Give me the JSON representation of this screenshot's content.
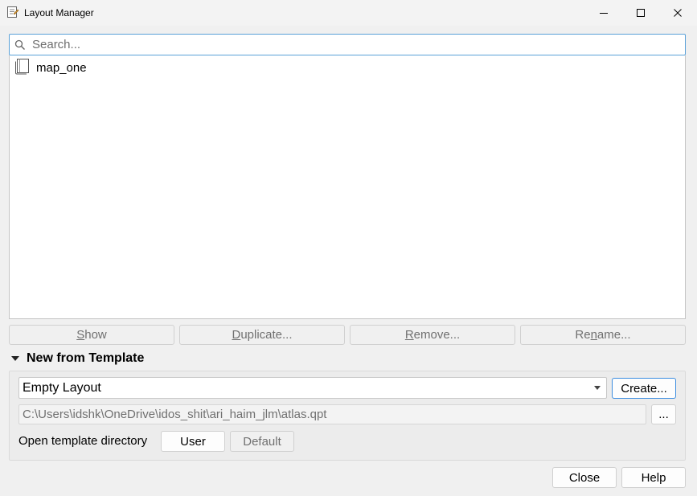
{
  "window": {
    "title": "Layout Manager",
    "icons": {
      "app": "layout-manager-icon",
      "minimize": "minimize-icon",
      "maximize": "maximize-icon",
      "close": "close-icon"
    }
  },
  "search": {
    "placeholder": "Search...",
    "value": "",
    "icon": "search-icon"
  },
  "layouts": {
    "items": [
      {
        "label": "map_one",
        "icon": "layout-page-icon"
      }
    ]
  },
  "actions": {
    "show": {
      "label": "Show",
      "underline": "S",
      "rest": "how",
      "enabled": false
    },
    "duplicate": {
      "label": "Duplicate...",
      "underline": "D",
      "rest": "uplicate...",
      "enabled": false
    },
    "remove": {
      "label": "Remove...",
      "underline": "R",
      "rest": "emove...",
      "enabled": false
    },
    "rename": {
      "label": "Rename...",
      "pre": "Re",
      "underline": "n",
      "rest": "ame...",
      "enabled": false
    }
  },
  "template_section": {
    "title": "New from Template",
    "expanded": true,
    "template_select": {
      "selected": "Empty Layout"
    },
    "create_label": "Create...",
    "template_path": "C:\\Users\\idshk\\OneDrive\\idos_shit\\ari_haim_jlm\\atlas.qpt",
    "browse_label": "...",
    "open_dir_label": "Open template directory",
    "user_label": "User",
    "default_label": "Default"
  },
  "footer": {
    "close_label": "Close",
    "help_label": "Help"
  },
  "colors": {
    "accent": "#3d8ee0",
    "focus_border": "#5aa1d8",
    "background": "#f0f0f0"
  }
}
